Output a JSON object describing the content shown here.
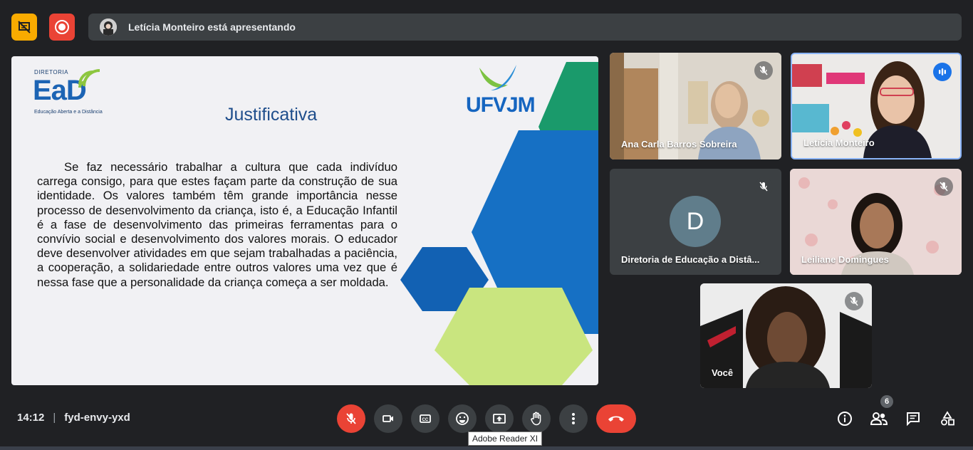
{
  "top_bar": {
    "presenting_text": "Letícia Monteiro está apresentando"
  },
  "slide": {
    "logo_small": "DIRETORIA",
    "logo_big": "EaD",
    "logo_sub": "Educação Aberta e a Distância",
    "brand": "UFVJM",
    "title": "Justificativa",
    "body": "Se faz necessário trabalhar a cultura que cada indivíduo carrega consigo, para que estes façam parte da construção de sua identidade. Os valores também têm grande importância nesse processo de desenvolvimento da criança, isto é, a Educação Infantil é a fase de desenvolvimento das primeiras ferramentas para o convívio social e desenvolvimento dos valores morais. O educador deve desenvolver atividades em que sejam trabalhadas a paciência, a cooperação, a solidariedade entre outros valores uma vez que é nessa fase que a personalidade da criança começa a ser moldada."
  },
  "participants": [
    {
      "name": "Ana Carla Barros Sobreira",
      "muted": true
    },
    {
      "name": "Letícia Monteiro",
      "speaking": true
    },
    {
      "name": "Diretoria de Educação a Distâ...",
      "initial": "D",
      "muted": true
    },
    {
      "name": "Leiliane Domingues",
      "muted": true
    },
    {
      "name": "Você",
      "muted": true
    }
  ],
  "bottom_bar": {
    "time": "14:12",
    "meeting_code": "fyd-envy-yxd",
    "tooltip": "Adobe Reader XI",
    "participant_count": "6"
  },
  "colors": {
    "bg": "#202124",
    "control": "#3c4043",
    "danger": "#ea4335",
    "accent": "#1a73e8",
    "warning": "#f9ab00"
  },
  "icons": [
    "presentation-off-icon",
    "record-icon",
    "mic-off-icon",
    "camera-icon",
    "captions-icon",
    "emoji-icon",
    "present-screen-icon",
    "raise-hand-icon",
    "more-options-icon",
    "hang-up-icon",
    "info-icon",
    "people-icon",
    "chat-icon",
    "activities-icon",
    "speaking-icon"
  ]
}
